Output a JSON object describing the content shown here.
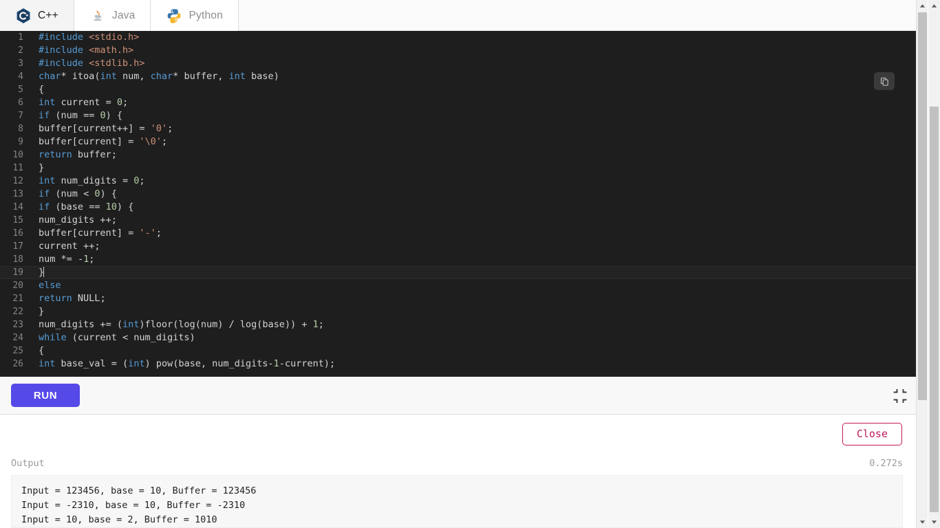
{
  "tabs": [
    {
      "label": "C++",
      "icon": "cplusplus-icon",
      "active": true
    },
    {
      "label": "Java",
      "icon": "java-icon",
      "active": false
    },
    {
      "label": "Python",
      "icon": "python-icon",
      "active": false
    }
  ],
  "editor": {
    "copy_icon": "copy-icon",
    "active_line": 19,
    "lines": [
      {
        "n": "1",
        "t": "#include <stdio.h>"
      },
      {
        "n": "2",
        "t": "#include <math.h>"
      },
      {
        "n": "3",
        "t": "#include <stdlib.h>"
      },
      {
        "n": "4",
        "t": "char* itoa(int num, char* buffer, int base)"
      },
      {
        "n": "5",
        "t": "{"
      },
      {
        "n": "6",
        "t": "int current = 0;"
      },
      {
        "n": "7",
        "t": "if (num == 0) {"
      },
      {
        "n": "8",
        "t": "buffer[current++] = '0';"
      },
      {
        "n": "9",
        "t": "buffer[current] = '\\0';"
      },
      {
        "n": "10",
        "t": "return buffer;"
      },
      {
        "n": "11",
        "t": "}"
      },
      {
        "n": "12",
        "t": "int num_digits = 0;"
      },
      {
        "n": "13",
        "t": "if (num < 0) {"
      },
      {
        "n": "14",
        "t": "if (base == 10) {"
      },
      {
        "n": "15",
        "t": "num_digits ++;"
      },
      {
        "n": "16",
        "t": "buffer[current] = '-';"
      },
      {
        "n": "17",
        "t": "current ++;"
      },
      {
        "n": "18",
        "t": "num *= -1;"
      },
      {
        "n": "19",
        "t": "}"
      },
      {
        "n": "20",
        "t": "else"
      },
      {
        "n": "21",
        "t": "return NULL;"
      },
      {
        "n": "22",
        "t": "}"
      },
      {
        "n": "23",
        "t": "num_digits += (int)floor(log(num) / log(base)) + 1;"
      },
      {
        "n": "24",
        "t": "while (current < num_digits)"
      },
      {
        "n": "25",
        "t": "{"
      },
      {
        "n": "26",
        "t": "int base_val = (int) pow(base, num_digits-1-current);"
      }
    ]
  },
  "runbar": {
    "run_label": "RUN",
    "collapse_icon": "collapse-icon"
  },
  "output": {
    "close_label": "Close",
    "title": "Output",
    "duration": "0.272s",
    "lines": [
      "Input = 123456, base = 10, Buffer = 123456",
      "Input = -2310, base = 10, Buffer = -2310",
      "Input = 10, base = 2, Buffer = 1010"
    ]
  },
  "colors": {
    "run_button": "#5549e8",
    "close_button": "#c2185b",
    "editor_bg": "#1e1e1e",
    "keyword": "#569cd6",
    "string": "#ce9178",
    "number": "#b5cea8"
  },
  "scrollbars": {
    "inner": {
      "up": "▲",
      "down": "▼"
    },
    "outer": {
      "up": "▲",
      "down": "▼"
    }
  }
}
